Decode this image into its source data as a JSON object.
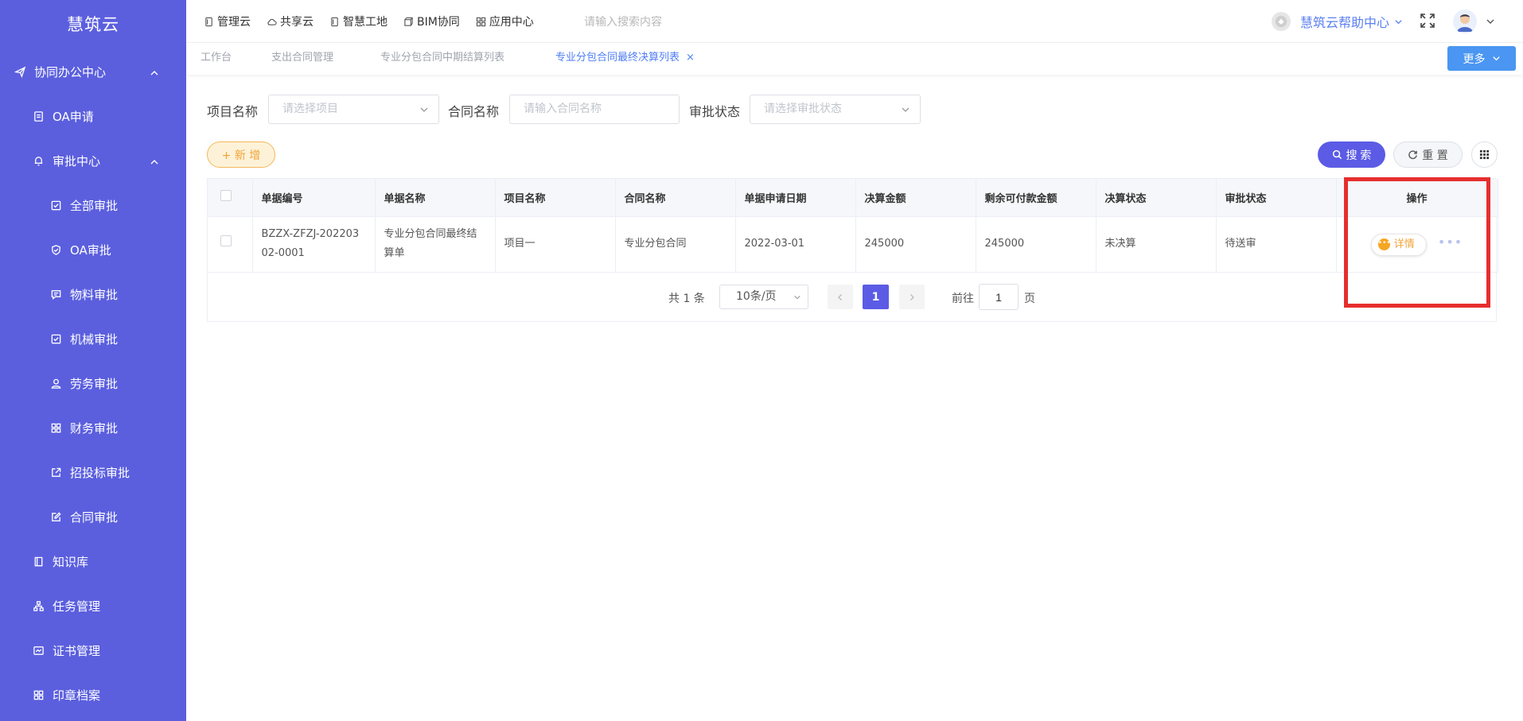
{
  "sidebar": {
    "brand": "慧筑云",
    "items": [
      {
        "label": "协同办公中心",
        "icon": "send-icon"
      },
      {
        "label": "OA申请",
        "icon": "document-icon"
      },
      {
        "label": "审批中心",
        "icon": "bell-icon"
      },
      {
        "label": "全部审批",
        "icon": "checkbox-icon"
      },
      {
        "label": "OA审批",
        "icon": "shield-check-icon"
      },
      {
        "label": "物料审批",
        "icon": "message-icon"
      },
      {
        "label": "机械审批",
        "icon": "checkbox-icon"
      },
      {
        "label": "劳务审批",
        "icon": "user-icon"
      },
      {
        "label": "财务审批",
        "icon": "grid-icon"
      },
      {
        "label": "招投标审批",
        "icon": "external-link-icon"
      },
      {
        "label": "合同审批",
        "icon": "edit-icon"
      },
      {
        "label": "知识库",
        "icon": "book-icon"
      },
      {
        "label": "任务管理",
        "icon": "hierarchy-icon"
      },
      {
        "label": "证书管理",
        "icon": "certificate-icon"
      },
      {
        "label": "印章档案",
        "icon": "grid-icon"
      }
    ]
  },
  "header": {
    "nav": [
      {
        "label": "管理云",
        "icon": "tablet-icon"
      },
      {
        "label": "共享云",
        "icon": "cloud-icon"
      },
      {
        "label": "智慧工地",
        "icon": "tablet-icon"
      },
      {
        "label": "BIM协同",
        "icon": "cube-icon"
      },
      {
        "label": "应用中心",
        "icon": "apps-icon"
      }
    ],
    "search_placeholder": "请输入搜索内容",
    "help_label": "慧筑云帮助中心"
  },
  "tabs": {
    "items": [
      "工作台",
      "支出合同管理",
      "专业分包合同中期结算列表",
      "专业分包合同最终决算列表"
    ],
    "close_glyph": "×",
    "more_label": "更多"
  },
  "filters": {
    "project_label": "项目名称",
    "project_placeholder": "请选择项目",
    "contract_label": "合同名称",
    "contract_placeholder": "请输入合同名称",
    "status_label": "审批状态",
    "status_placeholder": "请选择审批状态"
  },
  "actions": {
    "add_label": "+ 新 增",
    "search_label": "搜 索",
    "reset_label": "重 置"
  },
  "table": {
    "columns": [
      "单据编号",
      "单据名称",
      "项目名称",
      "合同名称",
      "单据申请日期",
      "决算金额",
      "剩余可付款金额",
      "决算状态",
      "审批状态",
      "操作"
    ],
    "rows": [
      {
        "doc_no_line1": "BZZX-ZFZJ-202203",
        "doc_no_line2": "02-0001",
        "doc_name_line1": "专业分包合同最终结",
        "doc_name_line2": "算单",
        "project": "项目一",
        "contract": "专业分包合同",
        "apply_date": "2022-03-01",
        "final_amount": "245000",
        "remaining_amount": "245000",
        "final_status": "未决算",
        "approval_status": "待送审",
        "detail_label": "详情",
        "more_glyph": "•••"
      }
    ]
  },
  "pagination": {
    "total_text": "共 1 条",
    "page_size": "10条/页",
    "current_page": "1",
    "goto_label": "前往",
    "goto_value": "1",
    "page_suffix": "页"
  },
  "colors": {
    "sidebar_bg": "#5b5fde",
    "primary": "#5b5be6",
    "accent_orange": "#f0a43a",
    "tab_active": "#4f7ef5",
    "highlight": "#e62e2e"
  }
}
